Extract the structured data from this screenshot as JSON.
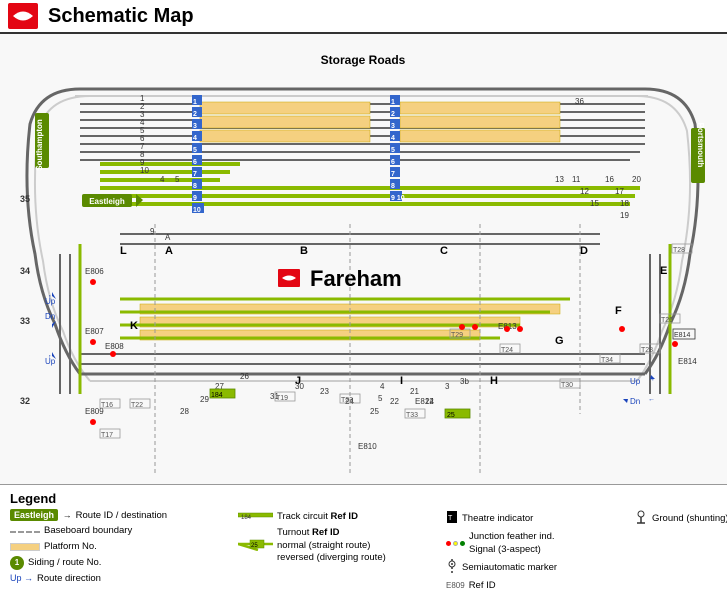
{
  "header": {
    "title": "Schematic Map"
  },
  "map": {
    "fareham_label": "Fareham",
    "storage_roads_label": "Storage Roads",
    "southampton_label": "Southampton",
    "portsmouth_label": "Portsmouth",
    "eastleigh_label": "Eastleigh"
  },
  "legend": {
    "title": "Legend",
    "items": [
      {
        "symbol": "eastleigh",
        "text": "Route ID / destination"
      },
      {
        "symbol": "track",
        "text": "Track circuit Ref ID"
      },
      {
        "symbol": "theatre",
        "text": "Theatre indicator"
      },
      {
        "symbol": "dashed",
        "text": "Baseboard boundary"
      },
      {
        "symbol": "turnout",
        "text": "Turnout Ref ID normal (straight route) reversed (diverging route)"
      },
      {
        "symbol": "junction",
        "text": "Junction feather ind. Signal (3-aspect)"
      },
      {
        "symbol": "platform",
        "text": "Platform No."
      },
      {
        "symbol": "semiAuto",
        "text": "Semiautomatic marker"
      },
      {
        "symbol": "siding",
        "text": "Siding / route No."
      },
      {
        "symbol": "routeDir",
        "text": "Route direction"
      },
      {
        "symbol": "e809",
        "text": "Ref ID"
      },
      {
        "symbol": "ground",
        "text": "Ground (shunting) signal"
      }
    ]
  }
}
